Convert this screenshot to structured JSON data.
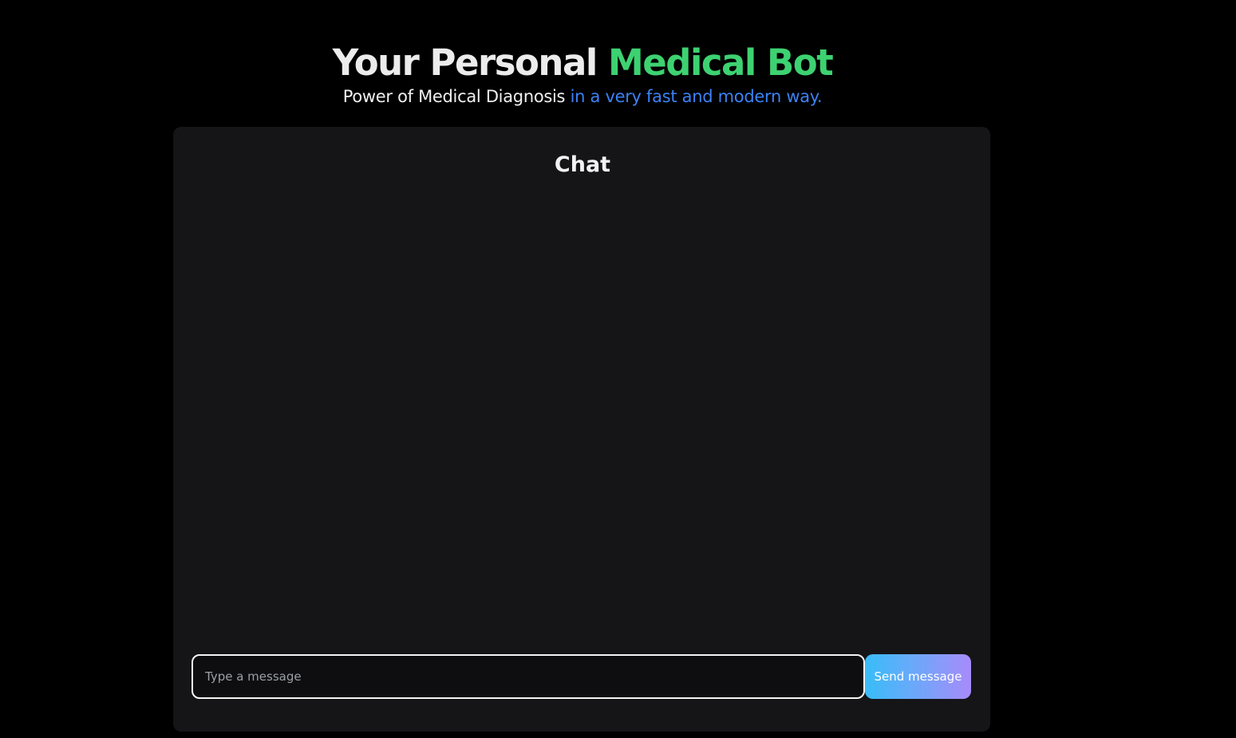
{
  "header": {
    "title_main": "Your Personal",
    "title_accent": "Medical Bot",
    "subtitle_main": "Power of Medical Diagnosis",
    "subtitle_accent": "in a very fast and modern way."
  },
  "chat": {
    "title": "Chat",
    "input_placeholder": "Type a message",
    "input_value": "",
    "send_label": "Send message"
  },
  "colors": {
    "page_background": "#000000",
    "card_background": "#151518",
    "title_accent": "#3dd271",
    "subtitle_accent": "#3b82f6",
    "button_gradient_start": "#38bdf8",
    "button_gradient_end": "#a78bfa"
  }
}
